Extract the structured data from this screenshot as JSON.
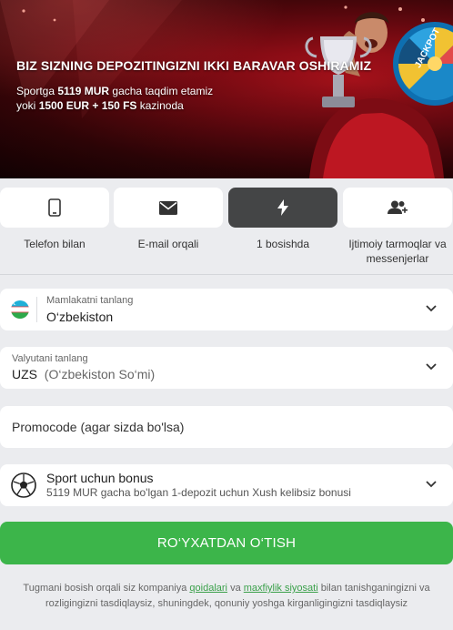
{
  "banner": {
    "title": "BIZ SIZNING DEPOZITINGIZNI IKKI BARAVAR OSHIRAMIZ",
    "sub_line1_prefix": "Sportga ",
    "sub_line1_bold": "5119 MUR",
    "sub_line1_suffix": " gacha taqdim etamiz",
    "sub_line2_prefix": "yoki ",
    "sub_line2_bold": "1500 EUR + 150 FS",
    "sub_line2_suffix": " kazinoda",
    "wheel_text": "JACKPOT"
  },
  "tabs": [
    {
      "label": "Telefon bilan",
      "icon": "phone-icon",
      "active": false
    },
    {
      "label": "E-mail orqali",
      "icon": "envelope-icon",
      "active": false
    },
    {
      "label": "1 bosishda",
      "icon": "lightning-icon",
      "active": true
    },
    {
      "label_line1": "Ijtimoiy tarmoqlar va",
      "label_line2": "messenjerlar",
      "icon": "users-icon",
      "active": false
    }
  ],
  "country": {
    "label": "Mamlakatni tanlang",
    "value": "O‘zbekiston",
    "icon": "uzbekistan-flag-icon"
  },
  "currency": {
    "label": "Valyutani tanlang",
    "code": "UZS",
    "name": "(O‘zbekiston So‘mi)"
  },
  "promo": {
    "placeholder": "Promocode (agar sizda bo'lsa)"
  },
  "bonus": {
    "title": "Sport uchun bonus",
    "description": "5119 MUR gacha bo'lgan 1-depozit uchun Xush kelibsiz bonusi",
    "icon": "soccer-ball-icon"
  },
  "submit": {
    "label": "RO‘YXATDAN O‘TISH"
  },
  "terms": {
    "part1": "Tugmani bosish orqali siz kompaniya ",
    "link1": "qoidalari",
    "part2": " va ",
    "link2": "maxfiylik siyosati",
    "part3": " bilan tanishganingizni va",
    "line2": "rozligingizni tasdiqlaysiz, shuningdek, qonuniy yoshga kirganligingizni tasdiqlaysiz"
  },
  "colors": {
    "accent_green": "#3cb54a",
    "banner_red": "#b0121c",
    "active_tab": "#444546",
    "page_bg": "#ebecef"
  }
}
